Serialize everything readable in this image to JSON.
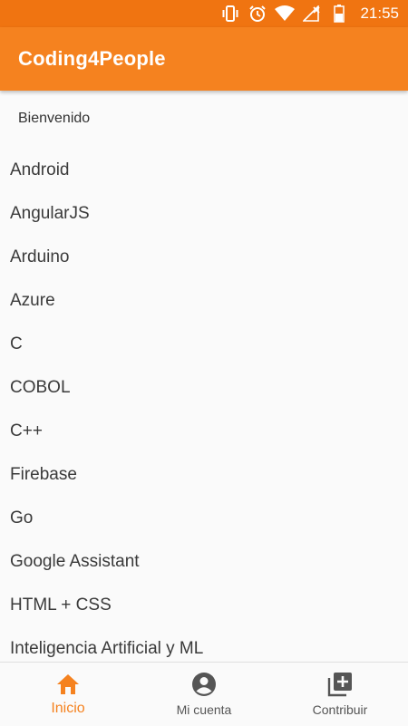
{
  "status_bar": {
    "time": "21:55",
    "icons": [
      "vibrate-icon",
      "alarm-icon",
      "wifi-icon",
      "signal-icon",
      "battery-icon"
    ]
  },
  "app_bar": {
    "title": "Coding4People"
  },
  "content": {
    "welcome": "Bienvenido",
    "topics": [
      "Android",
      "AngularJS",
      "Arduino",
      "Azure",
      "C",
      "COBOL",
      "C++",
      "Firebase",
      "Go",
      "Google Assistant",
      "HTML + CSS",
      "Inteligencia Artificial y ML"
    ]
  },
  "bottom_nav": {
    "items": [
      {
        "label": "Inicio",
        "icon": "home-icon",
        "active": true
      },
      {
        "label": "Mi cuenta",
        "icon": "account-icon",
        "active": false
      },
      {
        "label": "Contribuir",
        "icon": "add-box-icon",
        "active": false
      }
    ]
  },
  "colors": {
    "primary": "#f5821f",
    "primary_dark": "#f07411",
    "background": "#fafafa",
    "text": "#3a3a3a"
  }
}
